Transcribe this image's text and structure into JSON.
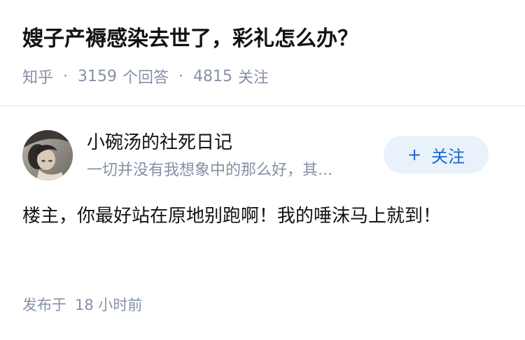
{
  "question": {
    "title": "嫂子产褥感染去世了，彩礼怎么办？",
    "source": "知乎",
    "separator": "·",
    "answer_count": "3159",
    "answer_label": "个回答",
    "follower_count": "4815",
    "follower_label": "关注"
  },
  "answer": {
    "author_name": "小碗汤的社死日记",
    "author_bio": "一切并没有我想象中的那么好，其...",
    "follow_plus": "+",
    "follow_label": "关注",
    "content": "楼主，你最好站在原地别跑啊！我的唾沫马上就到！",
    "publish_label": "发布于",
    "publish_time": "18 小时前"
  },
  "colors": {
    "title_text": "#121212",
    "meta_text": "#8590a6",
    "follow_button_bg": "#e9f1fb",
    "follow_button_text": "#1a66c8",
    "divider": "#f2f2f2"
  }
}
